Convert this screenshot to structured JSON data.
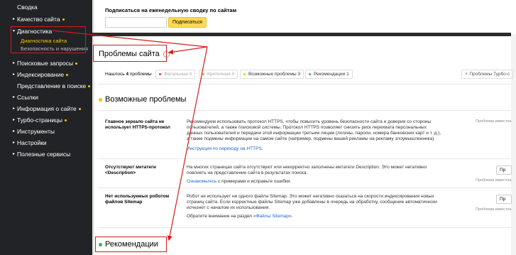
{
  "sidebar": {
    "items": [
      {
        "label": "Сводка",
        "caret": false,
        "dot": false
      },
      {
        "label": "Качество сайта",
        "caret": true,
        "dot": true
      },
      {
        "label": "Диагностика",
        "caret": true,
        "dot": false
      },
      {
        "label": "Поисковые запросы",
        "caret": true,
        "dot": true
      },
      {
        "label": "Индексирование",
        "caret": true,
        "dot": true
      },
      {
        "label": "Представление в поиске",
        "caret": true,
        "dot": true
      },
      {
        "label": "Ссылки",
        "caret": true,
        "dot": false
      },
      {
        "label": "Информация о сайте",
        "caret": true,
        "dot": true
      },
      {
        "label": "Турбо-страницы",
        "caret": true,
        "dot": true
      },
      {
        "label": "Инструменты",
        "caret": true,
        "dot": false
      },
      {
        "label": "Настройки",
        "caret": true,
        "dot": false
      },
      {
        "label": "Полезные сервисы",
        "caret": true,
        "dot": false
      }
    ],
    "subitems": [
      {
        "label": "Диагностика сайта",
        "active": true
      },
      {
        "label": "Безопасность и нарушения",
        "active": false
      }
    ]
  },
  "subscribe": {
    "label": "Подписаться на еженедельную сводку по сайтам",
    "input_value": "",
    "button": "Подписаться"
  },
  "main": {
    "title": "Проблемы сайта",
    "info_icon": "i",
    "filters": {
      "count_prefix": "Нашлось",
      "count_value": "4",
      "count_suffix": "проблемы",
      "chips": [
        {
          "label": "Фатальные 0",
          "color": "#e0443a",
          "dim": true
        },
        {
          "label": "Критичные 0",
          "color": "#f29a34",
          "dim": true
        },
        {
          "label": "Возможные проблемы 3",
          "color": "#f5c400",
          "dim": false
        },
        {
          "label": "Рекомендации 1",
          "color": "#3bb54a",
          "dim": false
        }
      ],
      "turbo": "Проблемы Турбо-с"
    },
    "sections": {
      "possible": {
        "title": "Возможные проблемы",
        "color": "#f5c400"
      },
      "recommendations": {
        "title": "Рекомендации",
        "color": "#3bb54a"
      }
    },
    "rows": [
      {
        "title": "Главное зеркало сайта не использует HTTPS-протокол",
        "text": "Рекомендуем использовать протокол HTTPS, чтобы повысить уровень безопасности сайта и доверия со стороны пользователей, а также поисковой системы. Протокол HTTPS позволяет снизить риск перехвата персональных данных пользователей и передачи этой информации третьим лицам (логины, пароли, номера банковских карт и т. д.), а также подмены информации на самом сайте (например, подмены вашей рекламы на рекламу злоумышленника).",
        "link": "Инструкция по переходу на HTTPS",
        "right_note": "Проблема известна"
      },
      {
        "title": "Отсутствуют метатеги <Description>",
        "text": "На многих страницах сайта отсутствуют или некорректно заполнены метатеги Description. Это может негативно повлиять на представление сайта в результатах поиска.",
        "link": "Ознакомьтесь",
        "link_suffix": "с примерами и исправьте ошибки.",
        "right_note": "Проблема известна",
        "button": "Пр"
      },
      {
        "title": "Нет используемых роботом файлов Sitemap",
        "text": "Робот не использует ни одного файла Sitemap. Это может негативно сказаться на скорости индексирования новых страниц сайта. Если корректные файлы Sitemap уже добавлены в очередь на обработку, сообщение автоматически исчезнет с началом их использования.",
        "note_prefix": "Обратите внимание на раздел «",
        "note_link": "Файлы Sitemap",
        "note_suffix": "».",
        "right_note": "Проблема известна",
        "button": "Пр"
      }
    ]
  },
  "colors": {
    "annotation": "#d31b1b",
    "sidebar_bg": "#222326",
    "accent": "#ffdb4d"
  }
}
